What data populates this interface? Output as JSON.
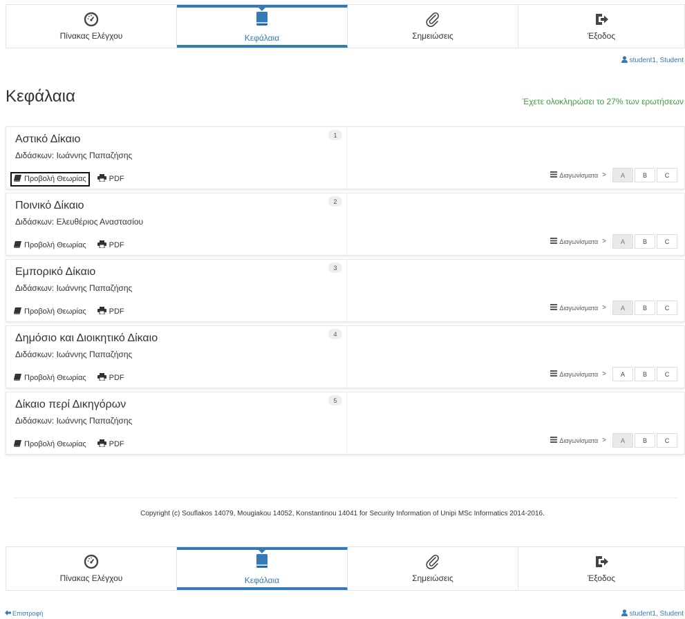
{
  "nav": [
    {
      "label": "Πίνακας Ελέγχου",
      "icon": "dashboard-icon"
    },
    {
      "label": "Κεφάλαια",
      "icon": "book-icon"
    },
    {
      "label": "Σημειώσεις",
      "icon": "paperclip-icon"
    },
    {
      "label": "Έξοδος",
      "icon": "sign-out-icon"
    }
  ],
  "user": {
    "text": "student1, Student",
    "icon": "user-icon"
  },
  "page": {
    "title": "Κεφάλαια",
    "progress": "Έχετε ολοκληρώσει το 27% των ερωτήσεων"
  },
  "labels": {
    "view_theory": "Προβολή Θεωρίας",
    "pdf": "PDF",
    "tests": "Διαγωνίσματα",
    "chevron": ">",
    "test_a": "A",
    "test_b": "B",
    "test_c": "C"
  },
  "chapters": [
    {
      "number": "1",
      "title": "Αστικό Δίκαιο",
      "instructor": "Διδάσκων: Ιωάννης Παπαζήσης"
    },
    {
      "number": "2",
      "title": "Ποινικό Δίκαιο",
      "instructor": "Διδάσκων: Ελευθέριος Αναστασίου"
    },
    {
      "number": "3",
      "title": "Εμπορικό Δίκαιο",
      "instructor": "Διδάσκων: Ιωάννης Παπαζήσης"
    },
    {
      "number": "4",
      "title": "Δημόσιο και Διοικητικό Δίκαιο",
      "instructor": "Διδάσκων: Ιωάννης Παπαζήσης"
    },
    {
      "number": "5",
      "title": "Δίκαιο περί Δικηγόρων",
      "instructor": "Διδάσκων: Ιωάννης Παπαζήσης"
    }
  ],
  "footer": {
    "copyright": "Copyright (c) Souflakos 14079, Mougiakou 14052, Konstantinou 14041 for Security Information of Unipi MSc Informatics 2014-2016.",
    "back": "Επιστροφή"
  },
  "colors": {
    "accent": "#337ab7",
    "progress": "#3c9d3c"
  }
}
